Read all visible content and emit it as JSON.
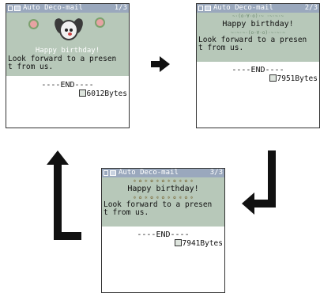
{
  "screens": [
    {
      "title": "Auto Deco-mail",
      "page": "1/3",
      "art_text": "Happy birthday!",
      "message_lines": [
        "Look forward to a presen",
        "t from us."
      ],
      "end_marker": "----END----",
      "size": "6012Bytes"
    },
    {
      "title": "Auto Deco-mail",
      "page": "2/3",
      "deco_top": "~·(o·∀·o)·~ ·~·~·~",
      "greeting": "Happy birthday!",
      "deco_bottom": "~·~·~·(o·∀·o)·~·~·~",
      "message_lines": [
        "Look forward to a presen",
        "t from us."
      ],
      "end_marker": "----END----",
      "size": "7951Bytes"
    },
    {
      "title": "Auto Deco-mail",
      "page": "3/3",
      "deco_top": "✲ ✿ ✲ ✿ ✲ ✿ ✲ ✿ ✲ ✿ ✲",
      "greeting": "Happy birthday!",
      "deco_bottom": "✲ ✿ ✲ ✿ ✲ ✿ ✲ ✿ ✲ ✿ ✲",
      "message_lines": [
        "Look forward to a presen",
        "t from us."
      ],
      "end_marker": "----END----",
      "size": "7941Bytes"
    }
  ],
  "icons": {
    "status": "signal-icon",
    "mail": "mail-icon",
    "attachment": "attachment-icon",
    "flow_arrows": [
      "arrow-right-icon",
      "arrow-down-left-icon",
      "arrow-up-left-icon"
    ]
  },
  "colors": {
    "titlebar": "#9aa8bd",
    "content_bg": "#b7c8b9",
    "arrow": "#111111"
  }
}
